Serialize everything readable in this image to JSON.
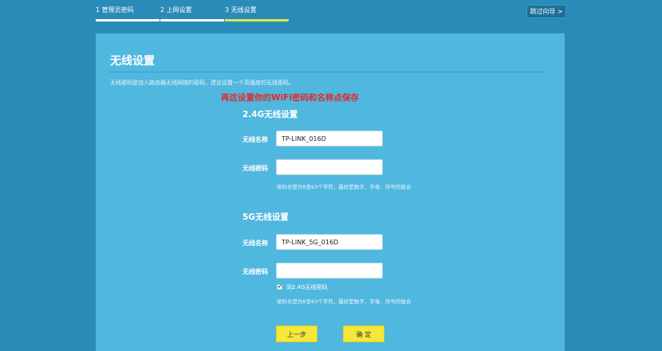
{
  "stepper": {
    "steps": [
      {
        "label": "1 管理员密码"
      },
      {
        "label": "2 上网设置"
      },
      {
        "label": "3 无线设置"
      }
    ]
  },
  "skip_button": {
    "label": "跳过向导 >"
  },
  "page": {
    "title": "无线设置",
    "description": "无线密码是加入路由器无线网络的密码，建议设置一个高强度的无线密码。",
    "annotation": "再这设置你的WiFi密码和名称点保存"
  },
  "wifi_24": {
    "section_title": "2.4G无线设置",
    "name_label": "无线名称",
    "name_value": "TP-LINK_016D",
    "password_label": "无线密码",
    "password_value": "",
    "hint": "密码长度为8至63个字符，最好是数字、字母、符号的组合"
  },
  "wifi_5": {
    "section_title": "5G无线设置",
    "name_label": "无线名称",
    "name_value": "TP-LINK_5G_016D",
    "password_label": "无线密码",
    "password_value": "",
    "same_as_24_label": "同2.4G无线密码",
    "same_as_24_checked": true,
    "hint": "密码长度为8至63个字符，最好是数字、字母、符号的组合"
  },
  "buttons": {
    "prev_label": "上一步",
    "confirm_label": "确 定"
  },
  "colors": {
    "background": "#2a8bb8",
    "panel": "#50b7df",
    "accent_yellow": "#f6e73b",
    "active_step": "#d6e84a",
    "annotation_red": "#e02b2b"
  }
}
